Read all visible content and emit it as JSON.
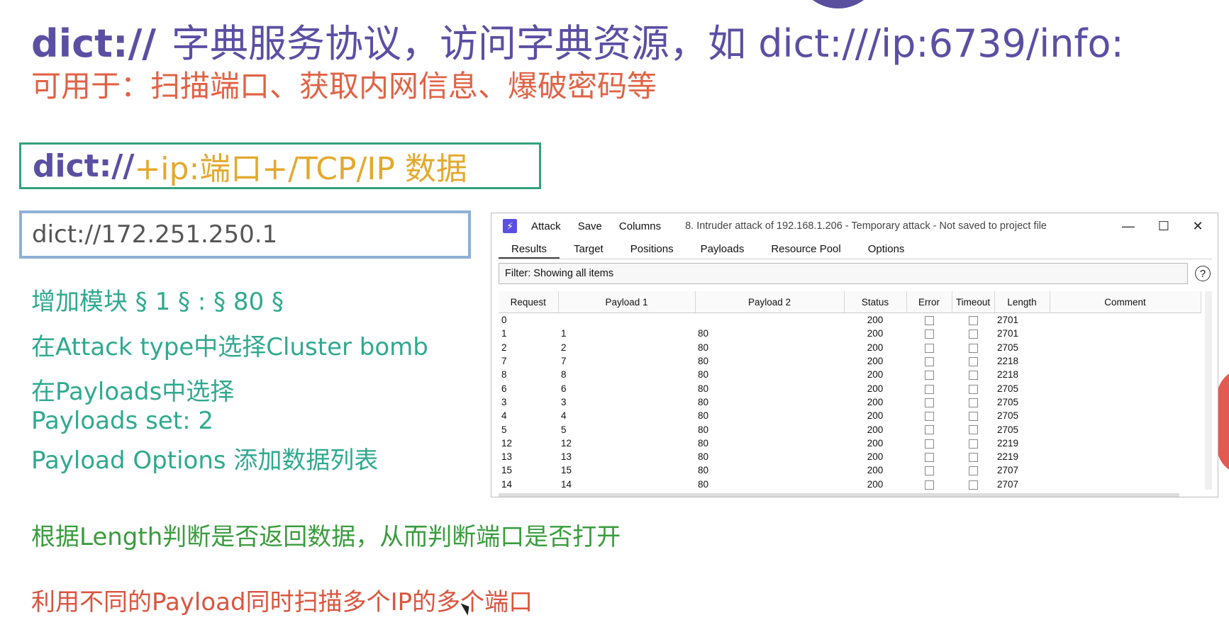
{
  "slide": {
    "title_kw": "dict://",
    "title_rest": "字典服务协议，访问字典资源，如 dict:///ip:6739/info:",
    "subtitle": "可用于：扫描端口、获取内网信息、爆破密码等",
    "syntax_kw": "dict://",
    "syntax_rest": "+ip:端口+/TCP/IP 数据",
    "url_value": "dict://172.251.250.1",
    "notes": [
      "增加模块 § 1 § : § 80 §",
      "在Attack type中选择Cluster bomb",
      "在Payloads中选择",
      "Payloads set: 2",
      "Payload Options 添加数据列表"
    ],
    "note_length": "根据Length判断是否返回数据，从而判断端口是否打开",
    "note_multi": "利用不同的Payload同时扫描多个IP的多个端口"
  },
  "burp": {
    "app_icon": "⚡",
    "menu": [
      "Attack",
      "Save",
      "Columns"
    ],
    "window_title": "8. Intruder attack of 192.168.1.206 - Temporary attack - Not saved to project file",
    "controls": {
      "minimize": "—",
      "maximize": "☐",
      "close": "✕"
    },
    "tabs": [
      "Results",
      "Target",
      "Positions",
      "Payloads",
      "Resource Pool",
      "Options"
    ],
    "filter": "Filter: Showing all items",
    "help": "?",
    "columns": [
      "Request",
      "Payload 1",
      "Payload 2",
      "Status",
      "Error",
      "Timeout",
      "Length",
      "Comment"
    ],
    "rows": [
      {
        "request": "0",
        "p1": "",
        "p2": "",
        "status": "200",
        "length": "2701"
      },
      {
        "request": "1",
        "p1": "1",
        "p2": "80",
        "status": "200",
        "length": "2701"
      },
      {
        "request": "2",
        "p1": "2",
        "p2": "80",
        "status": "200",
        "length": "2705"
      },
      {
        "request": "7",
        "p1": "7",
        "p2": "80",
        "status": "200",
        "length": "2218"
      },
      {
        "request": "8",
        "p1": "8",
        "p2": "80",
        "status": "200",
        "length": "2218"
      },
      {
        "request": "6",
        "p1": "6",
        "p2": "80",
        "status": "200",
        "length": "2705"
      },
      {
        "request": "3",
        "p1": "3",
        "p2": "80",
        "status": "200",
        "length": "2705"
      },
      {
        "request": "4",
        "p1": "4",
        "p2": "80",
        "status": "200",
        "length": "2705"
      },
      {
        "request": "5",
        "p1": "5",
        "p2": "80",
        "status": "200",
        "length": "2705"
      },
      {
        "request": "12",
        "p1": "12",
        "p2": "80",
        "status": "200",
        "length": "2219"
      },
      {
        "request": "13",
        "p1": "13",
        "p2": "80",
        "status": "200",
        "length": "2219"
      },
      {
        "request": "15",
        "p1": "15",
        "p2": "80",
        "status": "200",
        "length": "2707"
      },
      {
        "request": "14",
        "p1": "14",
        "p2": "80",
        "status": "200",
        "length": "2707"
      }
    ]
  },
  "colors": {
    "title": "#5b4fa3",
    "subtitle": "#e06346",
    "syntax_border": "#33a17a",
    "syntax_rest": "#e3a92e",
    "note_teal": "#2fa98f",
    "note_green": "#3a9c3e",
    "note_red": "#d9553f"
  }
}
